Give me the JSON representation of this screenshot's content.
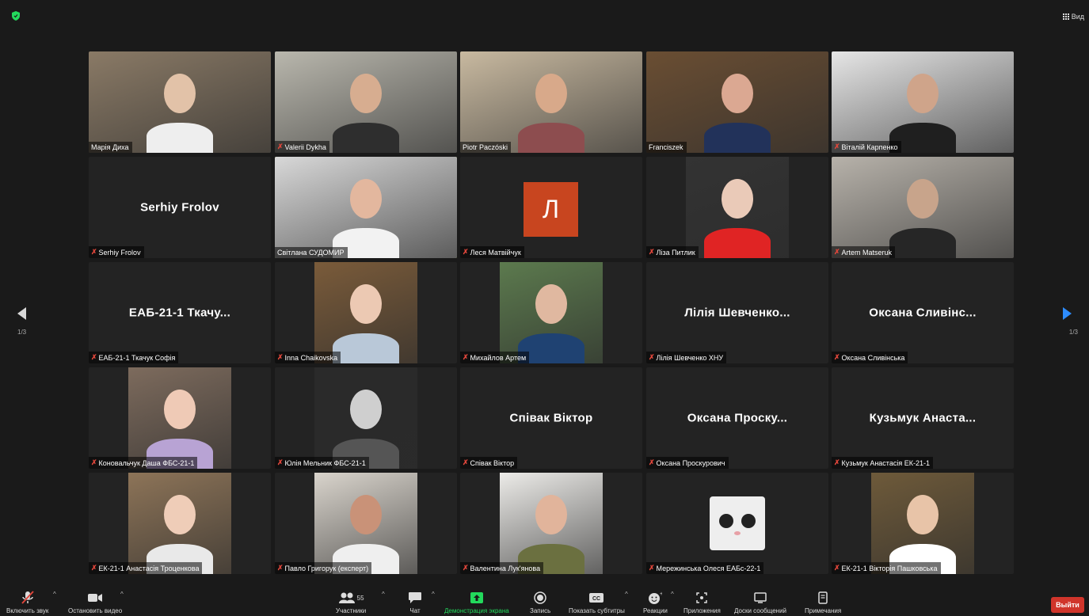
{
  "top": {
    "view_label": "Вид"
  },
  "pagination": {
    "left": "1/3",
    "right": "1/3"
  },
  "tiles": [
    {
      "label": "Марія Диха",
      "muted": false,
      "bigname": "",
      "avatar": "",
      "bg": "#8a7a66",
      "skin": "#e2c2a8",
      "shirt": "#eeeeee"
    },
    {
      "label": "Valerii Dykha",
      "muted": true,
      "bigname": "",
      "avatar": "",
      "bg": "#b9b7ad",
      "skin": "#d7ad90",
      "shirt": "#2e2e2e"
    },
    {
      "label": "Piotr Paczóski",
      "muted": false,
      "bigname": "",
      "avatar": "",
      "bg": "#c8b9a0",
      "skin": "#d8a98a",
      "shirt": "#8d4d4f"
    },
    {
      "label": "Franciszek",
      "muted": false,
      "bigname": "",
      "avatar": "",
      "bg": "#6a4e33",
      "skin": "#dba892",
      "shirt": "#22325a"
    },
    {
      "label": "Віталій Карпенко",
      "muted": true,
      "bigname": "",
      "avatar": "",
      "bg": "#e6e6e6",
      "skin": "#cfa48a",
      "shirt": "#1f1f1f"
    },
    {
      "label": "Serhiy Frolov",
      "muted": true,
      "bigname": "Serhiy Frolov",
      "avatar": "",
      "bg": "",
      "skin": "",
      "shirt": ""
    },
    {
      "label": "Світлана СУДОМИР",
      "muted": false,
      "bigname": "",
      "avatar": "",
      "bg": "#d8d8d8",
      "skin": "#e3b79e",
      "shirt": "#f2f2f2",
      "active": true
    },
    {
      "label": "Леся Матвійчук",
      "muted": true,
      "bigname": "",
      "avatar": "Л",
      "bg": "",
      "skin": "",
      "shirt": ""
    },
    {
      "label": "Ліза Питлик",
      "muted": true,
      "bigname": "",
      "avatar": "",
      "bg": "#333333",
      "skin": "#eacab8",
      "shirt": "#e02424"
    },
    {
      "label": "Artem Matseruk",
      "muted": true,
      "bigname": "",
      "avatar": "",
      "bg": "#b7b2aa",
      "skin": "#c8a48b",
      "shirt": "#262626"
    },
    {
      "label": "ЕАБ-21-1 Ткачук Софія",
      "muted": true,
      "bigname": "ЕАБ-21-1 Ткачу...",
      "avatar": "",
      "bg": "",
      "skin": "",
      "shirt": ""
    },
    {
      "label": "Inna Chaikovska",
      "muted": true,
      "bigname": "",
      "avatar": "",
      "bg": "#7a5b3a",
      "skin": "#ecc9b3",
      "shirt": "#b9c8d8"
    },
    {
      "label": "Михайлов Артем",
      "muted": true,
      "bigname": "",
      "avatar": "",
      "bg": "#5c7a4e",
      "skin": "#e0b8a0",
      "shirt": "#1f4272"
    },
    {
      "label": "Лілія Шевченко ХНУ",
      "muted": true,
      "bigname": "Лілія Шевченко...",
      "avatar": "",
      "bg": "",
      "skin": "",
      "shirt": ""
    },
    {
      "label": "Оксана Сливінська",
      "muted": true,
      "bigname": "Оксана Сливінс...",
      "avatar": "",
      "bg": "",
      "skin": "",
      "shirt": ""
    },
    {
      "label": "Коновальчук Даша ФБС-21-1",
      "muted": true,
      "bigname": "",
      "avatar": "",
      "bg": "#7d6b5d",
      "skin": "#efcab6",
      "shirt": "#b8a3d4"
    },
    {
      "label": "Юлія Мельник ФБС-21-1",
      "muted": true,
      "bigname": "",
      "avatar": "",
      "bg": "#2a2a2a",
      "skin": "#cfcfcf",
      "shirt": "#555555"
    },
    {
      "label": "Співак Віктор",
      "muted": true,
      "bigname": "Співак Віктор",
      "avatar": "",
      "bg": "",
      "skin": "",
      "shirt": ""
    },
    {
      "label": "Оксана Проскурович",
      "muted": true,
      "bigname": "Оксана Проску...",
      "avatar": "",
      "bg": "",
      "skin": "",
      "shirt": ""
    },
    {
      "label": "Кузьмук Анастасія ЕК-21-1",
      "muted": true,
      "bigname": "Кузьмук Анаста...",
      "avatar": "",
      "bg": "",
      "skin": "",
      "shirt": ""
    },
    {
      "label": "ЕК-21-1 Анастасія Троценкова",
      "muted": true,
      "bigname": "",
      "avatar": "",
      "bg": "#8d7458",
      "skin": "#efcdb8",
      "shirt": "#e9e9e9"
    },
    {
      "label": "Павло Григорук (експерт)",
      "muted": true,
      "bigname": "",
      "avatar": "",
      "bg": "#d9d4cc",
      "skin": "#c99278",
      "shirt": "#efefef"
    },
    {
      "label": "Валентина Лук'янова",
      "muted": true,
      "bigname": "",
      "avatar": "",
      "bg": "#ecebe8",
      "skin": "#e1b49b",
      "shirt": "#6b7040"
    },
    {
      "label": "Мережинська Олеся ЕАБс-22-1",
      "muted": true,
      "bigname": "",
      "avatar": "",
      "bg": "",
      "skin": "",
      "shirt": "",
      "cat": true
    },
    {
      "label": "ЕК-21-1 Вікторія Пашковська",
      "muted": true,
      "bigname": "",
      "avatar": "",
      "bg": "#6e5a3a",
      "skin": "#e8c4a8",
      "shirt": "#ffffff"
    }
  ],
  "toolbar": {
    "unmute": "Включить звук",
    "stop_video": "Остановить видео",
    "participants": "Участники",
    "participants_count": "55",
    "chat": "Чат",
    "share": "Демонстрация экрана",
    "record": "Запись",
    "captions": "Показать субтитры",
    "reactions": "Реакции",
    "apps": "Приложения",
    "whiteboards": "Доски сообщений",
    "notes": "Примечания",
    "leave": "Выйти"
  },
  "colors": {
    "share_green": "#23d95c",
    "leave_red": "#d0352b",
    "active_border": "#c9e265",
    "avatar_orange": "#c8451f"
  }
}
